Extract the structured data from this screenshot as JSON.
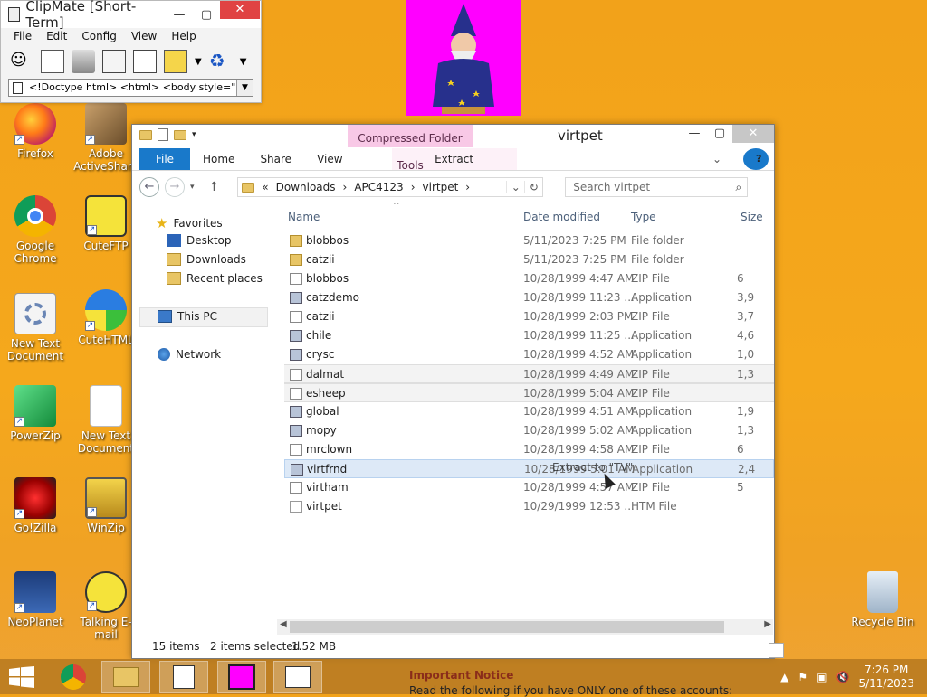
{
  "clipmate": {
    "title": "ClipMate [Short-Term]",
    "menu": [
      "File",
      "Edit",
      "Config",
      "View",
      "Help"
    ],
    "clip_preview": "<!Doctype html> <html> <body style=\"backgrour"
  },
  "desktop_icons": [
    {
      "label": "Firefox",
      "icon": "firefox-icon"
    },
    {
      "label": "Adobe ActiveShare",
      "icon": "adobe-activeshare-icon"
    },
    {
      "label": "Google Chrome",
      "icon": "chrome-icon"
    },
    {
      "label": "CuteFTP",
      "icon": "cuteftp-icon"
    },
    {
      "label": "New Text Document",
      "icon": "settings-document-icon"
    },
    {
      "label": "CuteHTML",
      "icon": "cutehtml-icon"
    },
    {
      "label": "PowerZip",
      "icon": "powerzip-icon"
    },
    {
      "label": "New Text Document",
      "icon": "text-document-icon"
    },
    {
      "label": "Go!Zilla",
      "icon": "gozilla-icon"
    },
    {
      "label": "WinZip",
      "icon": "winzip-icon"
    },
    {
      "label": "NeoPlanet",
      "icon": "neoplanet-icon"
    },
    {
      "label": "Talking E-mail",
      "icon": "talking-email-icon"
    },
    {
      "label": "Recycle Bin",
      "icon": "recycle-bin-icon"
    }
  ],
  "explorer": {
    "title": "virtpet",
    "context_tab": "Compressed Folder Tools",
    "ribbon_tabs": [
      "File",
      "Home",
      "Share",
      "View"
    ],
    "ribbon_context": "Extract",
    "breadcrumb": [
      "Downloads",
      "APC4123",
      "virtpet"
    ],
    "breadcrumb_prefix": "«",
    "search_placeholder": "Search virtpet",
    "nav": {
      "favorites": "Favorites",
      "desktop": "Desktop",
      "downloads": "Downloads",
      "recent": "Recent places",
      "this_pc": "This PC",
      "network": "Network"
    },
    "columns": {
      "name": "Name",
      "date": "Date modified",
      "type": "Type",
      "size": "Size"
    },
    "files": [
      {
        "name": "blobbos",
        "date": "5/11/2023 7:25 PM",
        "type": "File folder",
        "size": "",
        "icon": "folder-icon"
      },
      {
        "name": "catzii",
        "date": "5/11/2023 7:25 PM",
        "type": "File folder",
        "size": "",
        "icon": "folder-icon"
      },
      {
        "name": "blobbos",
        "date": "10/28/1999 4:47 AM",
        "type": "ZIP File",
        "size": "6",
        "icon": "zip-file-icon"
      },
      {
        "name": "catzdemo",
        "date": "10/28/1999 11:23 ...",
        "type": "Application",
        "size": "3,9",
        "icon": "application-icon"
      },
      {
        "name": "catzii",
        "date": "10/28/1999 2:03 PM",
        "type": "ZIP File",
        "size": "3,7",
        "icon": "zip-file-icon"
      },
      {
        "name": "chile",
        "date": "10/28/1999 11:25 ...",
        "type": "Application",
        "size": "4,6",
        "icon": "application-icon"
      },
      {
        "name": "crysc",
        "date": "10/28/1999 4:52 AM",
        "type": "Application",
        "size": "1,0",
        "icon": "application-icon"
      },
      {
        "name": "dalmat",
        "date": "10/28/1999 4:49 AM",
        "type": "ZIP File",
        "size": "1,3",
        "icon": "zip-file-icon"
      },
      {
        "name": "esheep",
        "date": "10/28/1999 5:04 AM",
        "type": "ZIP File",
        "size": "",
        "icon": "zip-file-icon"
      },
      {
        "name": "global",
        "date": "10/28/1999 4:51 AM",
        "type": "Application",
        "size": "1,9",
        "icon": "application-icon"
      },
      {
        "name": "mopy",
        "date": "10/28/1999 5:02 AM",
        "type": "Application",
        "size": "1,3",
        "icon": "application-icon"
      },
      {
        "name": "mrclown",
        "date": "10/28/1999 4:58 AM",
        "type": "ZIP File",
        "size": "6",
        "icon": "zip-file-icon"
      },
      {
        "name": "virtfrnd",
        "date": "10/28/1999 5:01 AM",
        "type": "Application",
        "size": "2,4",
        "icon": "application-icon"
      },
      {
        "name": "virtham",
        "date": "10/28/1999 4:57 AM",
        "type": "ZIP File",
        "size": "5",
        "icon": "zip-file-icon"
      },
      {
        "name": "virtpet",
        "date": "10/29/1999 12:53 ...",
        "type": "HTM File",
        "size": "",
        "icon": "htm-file-icon"
      }
    ],
    "drag_tooltip": "Extract to \"TV\"",
    "status": {
      "items": "15 items",
      "selected": "2 items selected",
      "size": "1.52 MB"
    }
  },
  "taskbar": {
    "notice_title": "Important Notice",
    "notice_text": "Read the following if you have ONLY one of these accounts:",
    "time": "7:26 PM",
    "date": "5/11/2023"
  },
  "colors": {
    "desktop": "#f2a21a",
    "accent": "#1979ca",
    "context_tab": "#f8c8e6",
    "wizard_bg": "#ff00ff"
  }
}
